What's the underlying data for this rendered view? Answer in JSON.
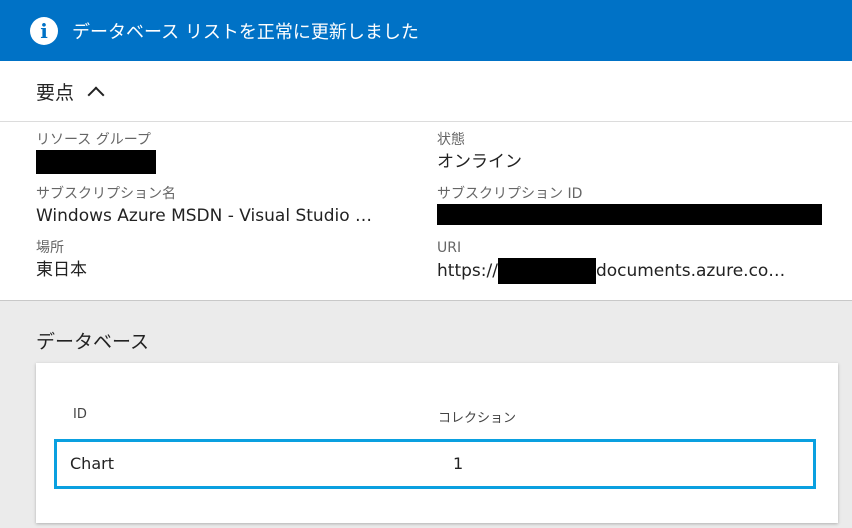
{
  "banner": {
    "icon": "info-icon",
    "text": "データベース リストを正常に更新しました",
    "color": "#0072c6"
  },
  "essentials": {
    "title": "要点"
  },
  "properties": {
    "resource_group": {
      "label": "リソース グループ",
      "value": ""
    },
    "status": {
      "label": "状態",
      "value": "オンライン"
    },
    "subscription_name": {
      "label": "サブスクリプション名",
      "value": "Windows Azure MSDN - Visual Studio …"
    },
    "subscription_id": {
      "label": "サブスクリプション ID",
      "value": ""
    },
    "location": {
      "label": "場所",
      "value": "東日本"
    },
    "uri": {
      "label": "URI",
      "prefix": "https://",
      "suffix": "documents.azure.co…"
    }
  },
  "databases": {
    "title": "データベース",
    "columns": [
      "ID",
      "コレクション"
    ],
    "rows": [
      {
        "id": "Chart",
        "collections": "1"
      }
    ],
    "selected_border_color": "#0aa0e0"
  }
}
